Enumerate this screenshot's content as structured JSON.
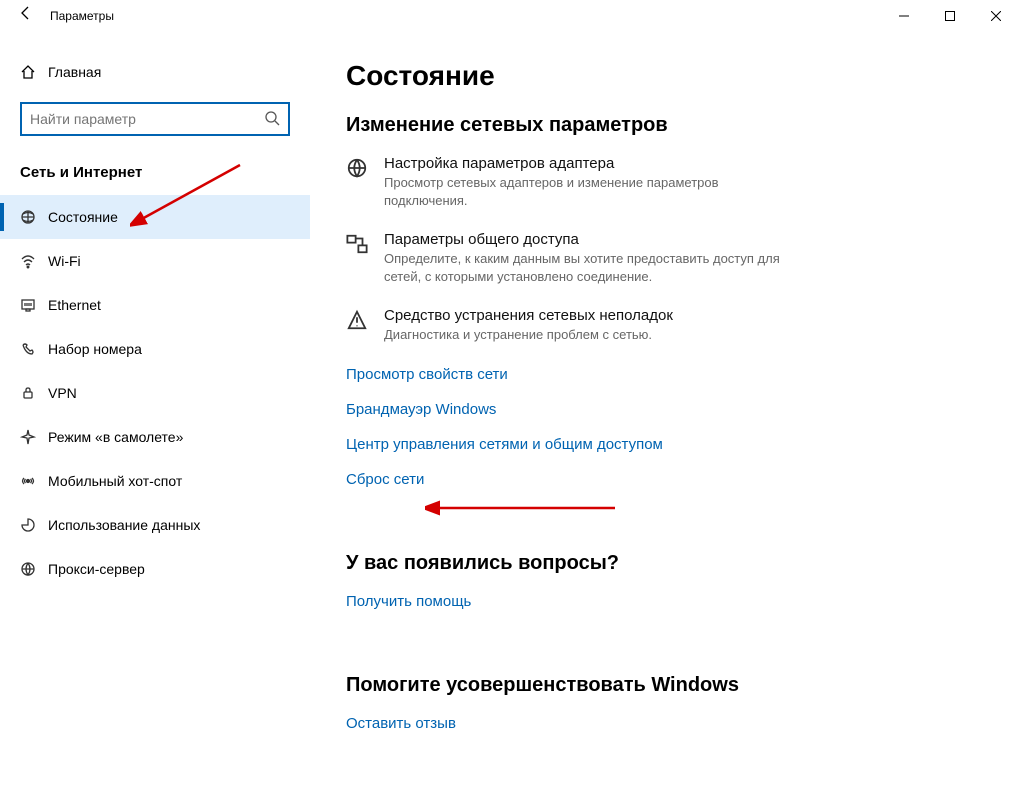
{
  "titlebar": {
    "app_title": "Параметры"
  },
  "sidebar": {
    "home_label": "Главная",
    "search_placeholder": "Найти параметр",
    "section_header": "Сеть и Интернет",
    "items": [
      {
        "label": "Состояние",
        "icon": "status-icon",
        "active": true
      },
      {
        "label": "Wi-Fi",
        "icon": "wifi-icon",
        "active": false
      },
      {
        "label": "Ethernet",
        "icon": "ethernet-icon",
        "active": false
      },
      {
        "label": "Набор номера",
        "icon": "dialup-icon",
        "active": false
      },
      {
        "label": "VPN",
        "icon": "vpn-icon",
        "active": false
      },
      {
        "label": "Режим «в самолете»",
        "icon": "airplane-icon",
        "active": false
      },
      {
        "label": "Мобильный хот-спот",
        "icon": "hotspot-icon",
        "active": false
      },
      {
        "label": "Использование данных",
        "icon": "data-usage-icon",
        "active": false
      },
      {
        "label": "Прокси-сервер",
        "icon": "proxy-icon",
        "active": false
      }
    ]
  },
  "content": {
    "page_title": "Состояние",
    "change_section_title": "Изменение сетевых параметров",
    "options": [
      {
        "title": "Настройка параметров адаптера",
        "desc": "Просмотр сетевых адаптеров и изменение параметров подключения."
      },
      {
        "title": "Параметры общего доступа",
        "desc": "Определите, к каким данным вы хотите предоставить доступ для сетей, с которыми установлено соединение."
      },
      {
        "title": "Средство устранения сетевых неполадок",
        "desc": "Диагностика и устранение проблем с сетью."
      }
    ],
    "links": [
      "Просмотр свойств сети",
      "Брандмауэр Windows",
      "Центр управления сетями и общим доступом",
      "Сброс сети"
    ],
    "questions_title": "У вас появились вопросы?",
    "questions_link": "Получить помощь",
    "feedback_title": "Помогите усовершенствовать Windows",
    "feedback_link": "Оставить отзыв"
  }
}
